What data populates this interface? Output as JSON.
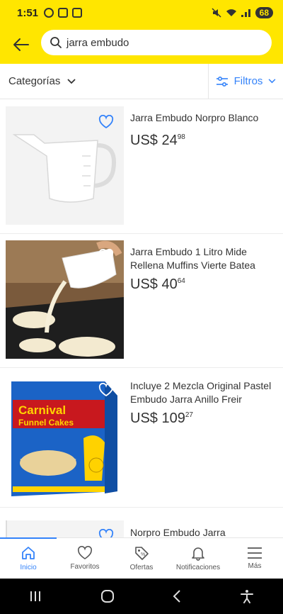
{
  "status_bar": {
    "time": "1:51",
    "battery": "68"
  },
  "search": {
    "query": "jarra embudo"
  },
  "filters": {
    "categories_label": "Categorías",
    "filters_label": "Filtros"
  },
  "items": [
    {
      "title": "Jarra Embudo Norpro Blanco",
      "currency": "US$",
      "price_int": "24",
      "price_cents": "98"
    },
    {
      "title": "Jarra Embudo 1 Litro Mide Rellena Muffins Vierte Batea",
      "currency": "US$",
      "price_int": "40",
      "price_cents": "64"
    },
    {
      "title": "Incluye 2 Mezcla Original Pastel Embudo Jarra Anillo Freir",
      "currency": "US$",
      "price_int": "109",
      "price_cents": "27"
    },
    {
      "title": "Norpro Embudo Jarra"
    }
  ],
  "product3_image_text": {
    "line1": "Carnival",
    "line2": "Funnel Cakes"
  },
  "bottom_nav": [
    {
      "label": "Inicio",
      "icon": "home-icon",
      "active": true
    },
    {
      "label": "Favoritos",
      "icon": "heart-icon"
    },
    {
      "label": "Ofertas",
      "icon": "tag-icon"
    },
    {
      "label": "Notificaciones",
      "icon": "bell-icon"
    },
    {
      "label": "Más",
      "icon": "menu-icon"
    }
  ],
  "colors": {
    "brand_yellow": "#ffe600",
    "accent_blue": "#3483fa"
  }
}
